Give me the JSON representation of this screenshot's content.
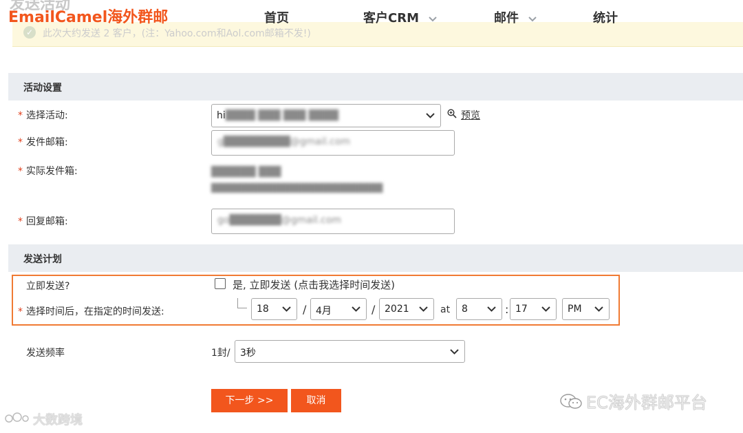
{
  "header": {
    "ghost_title": "发送活动",
    "logo": "EmailCamel海外群邮",
    "nav": [
      {
        "label": "首页",
        "has_dropdown": false
      },
      {
        "label": "客户CRM",
        "has_dropdown": true
      },
      {
        "label": "邮件",
        "has_dropdown": true
      },
      {
        "label": "统计",
        "has_dropdown": false
      }
    ],
    "notice": "此次大约发送 2 客户，(注：Yahoo.com和Aol.com邮箱不发!)"
  },
  "activity_settings": {
    "section_title": "活动设置",
    "select_activity_label": "选择活动:",
    "select_activity_value": "hi",
    "select_activity_blurred": "████ ███ ███ ████",
    "preview_label": "预览",
    "sender_email_label": "发件邮箱:",
    "sender_email_value": "g█████████@gmail.com",
    "actual_sender_label": "实际发件箱:",
    "actual_sender_line1": "██████ ███",
    "actual_sender_line2": "███████████████████████████",
    "reply_email_label": "回复邮箱:",
    "reply_email_value": "go███████@gmail.com"
  },
  "send_plan": {
    "section_title": "发送计划",
    "send_now_label": "立即发送?",
    "send_now_checkbox_label": "是, 立即发送 (点击我选择时间发送)",
    "send_now_checked": false,
    "schedule_label": "选择时间后，在指定的时间发送:",
    "day": "18",
    "month": "4月",
    "year": "2021",
    "at_label": "at",
    "hour": "8",
    "minute": "17",
    "ampm": "PM",
    "date_separator": "/",
    "time_separator": ":"
  },
  "frequency": {
    "label": "发送频率",
    "prefix": "1封/",
    "value": "3秒"
  },
  "buttons": {
    "next": "下一步 >>",
    "cancel": "取消"
  },
  "watermarks": {
    "left": "大数跨境",
    "right": "EC海外群邮平台"
  },
  "colors": {
    "brand": "#f2561d",
    "highlight_border": "#f07a33",
    "section_bg": "#eaedf1",
    "required": "#e0411e"
  }
}
